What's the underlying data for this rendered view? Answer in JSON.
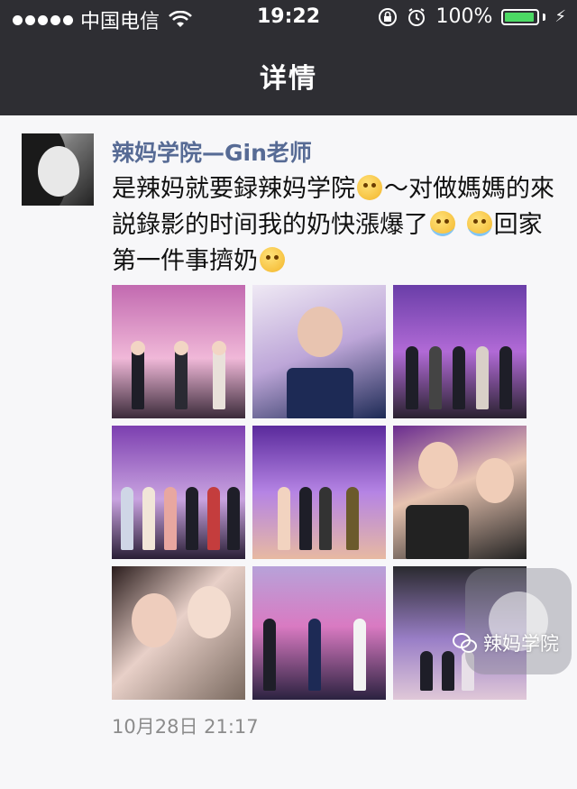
{
  "status_bar": {
    "carrier": "中国电信",
    "time": "19:22",
    "battery": "100%"
  },
  "nav": {
    "title": "详情"
  },
  "post": {
    "author": "辣妈学院—Gin老师",
    "text_1": "是辣妈就要録辣妈学院",
    "text_2": "～对做媽媽的來説錄影的时间我的奶快漲爆了",
    "text_3": "回家第一件事擠奶",
    "timestamp": "10月28日 21:17"
  },
  "watermark": {
    "label": "辣妈学院"
  },
  "icons": {
    "signal": "signal-dots-icon",
    "wifi": "wifi-icon",
    "orientation_lock": "orientation-lock-icon",
    "alarm": "alarm-icon",
    "battery": "battery-icon",
    "charging": "charging-bolt-icon",
    "wechat": "wechat-icon"
  },
  "colors": {
    "bar_background": "#2e2e33",
    "author_link": "#576b95",
    "battery_fill": "#4cd964",
    "timestamp": "#8c8c8c"
  }
}
